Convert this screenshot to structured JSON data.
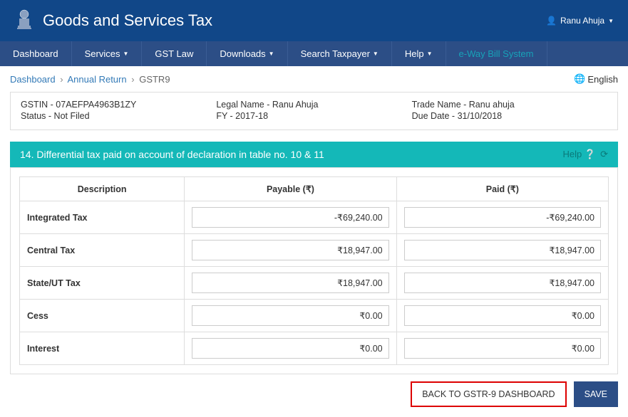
{
  "header": {
    "title": "Goods and Services Tax",
    "user": "Ranu Ahuja"
  },
  "nav": {
    "dashboard": "Dashboard",
    "services": "Services",
    "gst_law": "GST Law",
    "downloads": "Downloads",
    "search_taxpayer": "Search Taxpayer",
    "help": "Help",
    "eway": "e-Way Bill System"
  },
  "breadcrumb": {
    "dashboard": "Dashboard",
    "annual_return": "Annual Return",
    "current": "GSTR9",
    "lang": "English"
  },
  "info": {
    "gstin": "GSTIN - 07AEFPA4963B1ZY",
    "status": "Status - Not Filed",
    "legal_name": "Legal Name - Ranu Ahuja",
    "fy": "FY - 2017-18",
    "trade_name": "Trade Name - Ranu ahuja",
    "due_date": "Due Date - 31/10/2018"
  },
  "section": {
    "title": "14. Differential tax paid on account of declaration in table no. 10 & 11",
    "help": "Help"
  },
  "table": {
    "headers": {
      "desc": "Description",
      "payable": "Payable (₹)",
      "paid": "Paid (₹)"
    },
    "rows": [
      {
        "desc": "Integrated Tax",
        "payable": "-₹69,240.00",
        "paid": "-₹69,240.00"
      },
      {
        "desc": "Central Tax",
        "payable": "₹18,947.00",
        "paid": "₹18,947.00"
      },
      {
        "desc": "State/UT Tax",
        "payable": "₹18,947.00",
        "paid": "₹18,947.00"
      },
      {
        "desc": "Cess",
        "payable": "₹0.00",
        "paid": "₹0.00"
      },
      {
        "desc": "Interest",
        "payable": "₹0.00",
        "paid": "₹0.00"
      }
    ]
  },
  "buttons": {
    "back": "BACK TO GSTR-9 DASHBOARD",
    "save": "SAVE"
  }
}
